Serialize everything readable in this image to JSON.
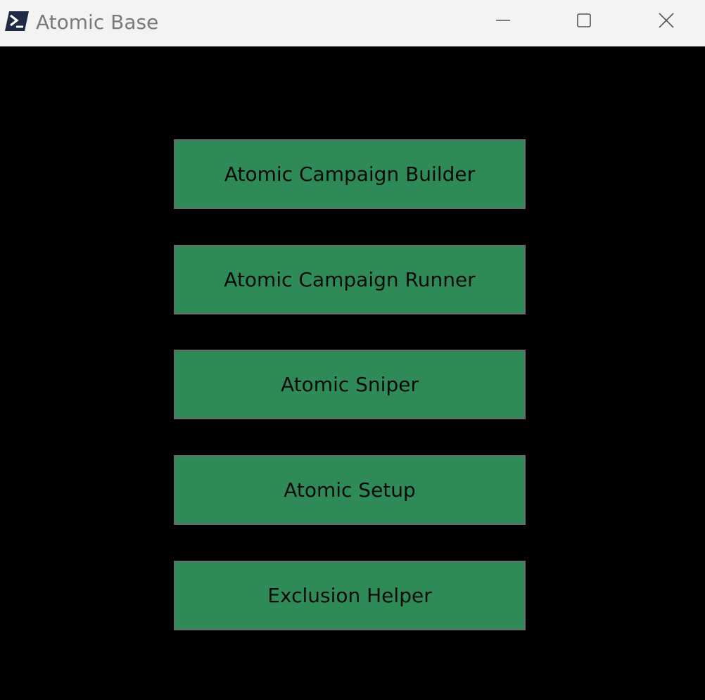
{
  "window": {
    "title": "Atomic Base",
    "icons": {
      "app": "powershell-icon",
      "minimize": "minimize-icon",
      "maximize": "maximize-icon",
      "close": "close-icon"
    }
  },
  "menu": {
    "buttons": [
      {
        "label": "Atomic Campaign Builder"
      },
      {
        "label": "Atomic Campaign Runner"
      },
      {
        "label": "Atomic Sniper"
      },
      {
        "label": "Atomic Setup"
      },
      {
        "label": "Exclusion Helper"
      }
    ]
  },
  "colors": {
    "background": "#000000",
    "button_fill": "#2e8b57",
    "button_border": "#6b6b6b",
    "titlebar": "#f3f3f3"
  }
}
